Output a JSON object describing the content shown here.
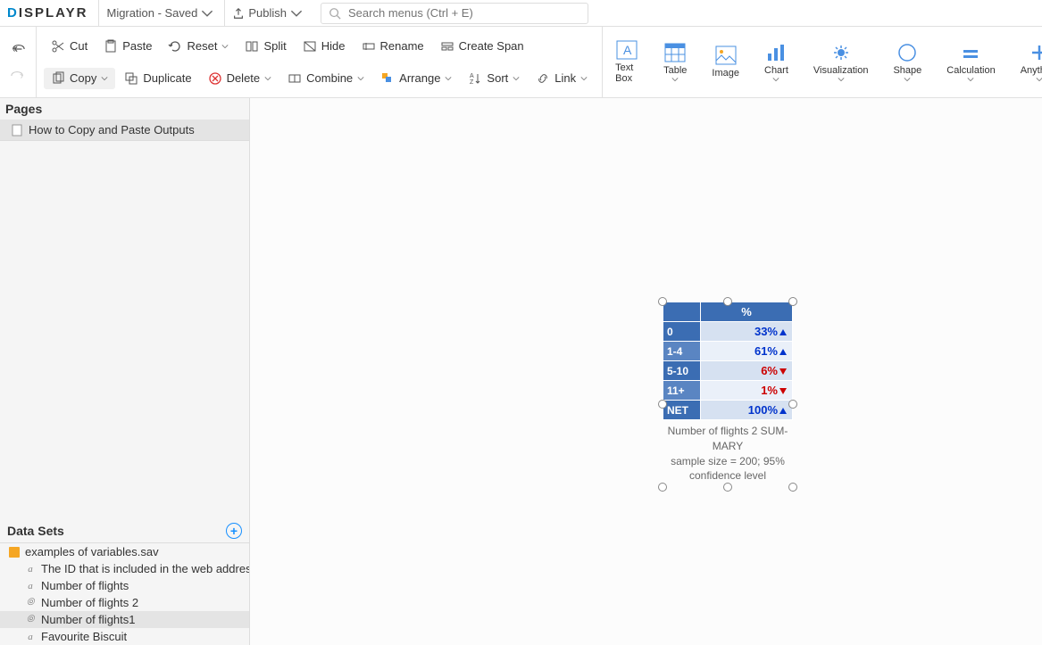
{
  "header": {
    "logo": "DISPLAYR",
    "doc_status": "Migration - Saved",
    "publish": "Publish",
    "search_placeholder": "Search menus (Ctrl + E)"
  },
  "toolbar": {
    "cut": "Cut",
    "paste": "Paste",
    "reset": "Reset",
    "split": "Split",
    "hide": "Hide",
    "rename": "Rename",
    "create_span": "Create Span",
    "copy": "Copy",
    "duplicate": "Duplicate",
    "delete": "Delete",
    "combine": "Combine",
    "arrange": "Arrange",
    "sort": "Sort",
    "link": "Link"
  },
  "insert": {
    "textbox": "Text Box",
    "table": "Table",
    "image": "Image",
    "chart": "Chart",
    "visualization": "Visualization",
    "shape": "Shape",
    "calculation": "Calculation",
    "anything": "Anything"
  },
  "sidebar": {
    "pages_header": "Pages",
    "pages": [
      {
        "label": "How to Copy and Paste Outputs"
      }
    ],
    "datasets_header": "Data Sets",
    "datasets_file": "examples of variables.sav",
    "variables": [
      {
        "label": "The ID that is included in the web addres",
        "type": "a"
      },
      {
        "label": "Number of flights",
        "type": "a"
      },
      {
        "label": "Number of flights 2",
        "type": "c"
      },
      {
        "label": "Number of flights1",
        "type": "c",
        "selected": true
      },
      {
        "label": "Favourite Biscuit",
        "type": "a"
      }
    ]
  },
  "chart_data": {
    "type": "table",
    "title_col": "%",
    "rows": [
      {
        "label": "0",
        "value": "33%",
        "dir": "up",
        "color": "blue",
        "alt": false
      },
      {
        "label": "1-4",
        "value": "61%",
        "dir": "up",
        "color": "blue",
        "alt": true
      },
      {
        "label": "5-10",
        "value": "6%",
        "dir": "down",
        "color": "red",
        "alt": false
      },
      {
        "label": "11+",
        "value": "1%",
        "dir": "down",
        "color": "red",
        "alt": true
      },
      {
        "label": "NET",
        "value": "100%",
        "dir": "up",
        "color": "blue",
        "alt": false
      }
    ],
    "caption1": "Number of flights 2 SUM-MARY",
    "caption2": "sample size = 200; 95% confidence level"
  }
}
